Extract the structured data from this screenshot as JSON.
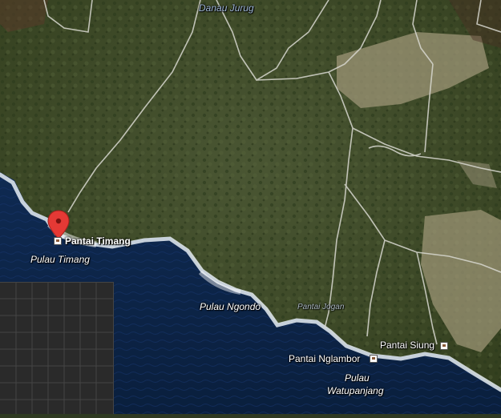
{
  "map": {
    "labels": {
      "danau_jurug": "Danau Jurug",
      "pantai_timang": "Pantai Timang",
      "pulau_timang": "Pulau Timang",
      "pulau_ngondo": "Pulau Ngondo",
      "pantai_jogan": "Pantai Jogan",
      "pantai_siung": "Pantai Siung",
      "pantai_nglambor": "Pantai Nglambor",
      "pulau_watupanjang_1": "Pulau",
      "pulau_watupanjang_2": "Watupanjang"
    },
    "colors": {
      "sea": "#0d2448",
      "land": "#3d4a2b",
      "road": "#d8d8d0",
      "surf": "#e8eef5",
      "pin": "#e53935"
    },
    "icons": [
      "location-pin-icon",
      "poi-marker-icon"
    ]
  }
}
